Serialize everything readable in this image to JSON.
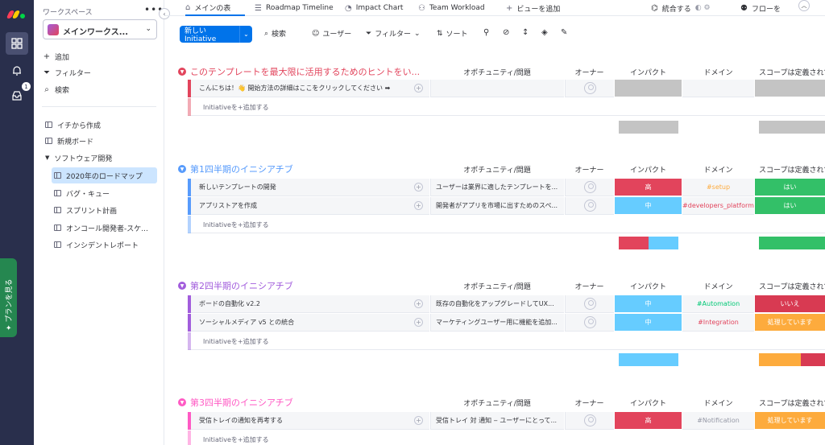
{
  "sidebar": {
    "workspace_label": "ワークスペース",
    "more_label": "•••",
    "workspace_name": "メインワークス...",
    "actions": [
      {
        "icon": "plus-icon",
        "label": "追加"
      },
      {
        "icon": "filter-icon",
        "label": "フィルター"
      },
      {
        "icon": "search-icon",
        "label": "検索"
      }
    ],
    "items": [
      {
        "label": "イチから作成"
      },
      {
        "label": "新規ボード"
      }
    ],
    "folder": {
      "label": "ソフトウェア開発"
    },
    "boards": [
      {
        "label": "2020年のロードマップ",
        "selected": true
      },
      {
        "label": "バグ・キュー"
      },
      {
        "label": "スプリント計画"
      },
      {
        "label": "オンコール開発者-スケ..."
      },
      {
        "label": "インシデントレポート"
      }
    ]
  },
  "rail": {
    "inbox_badge": "1",
    "plan_label": "プランを見る"
  },
  "tabs": {
    "items": [
      {
        "label": "メインの表",
        "active": true
      },
      {
        "label": "Roadmap Timeline"
      },
      {
        "label": "Impact Chart"
      },
      {
        "label": "Team Workload"
      },
      {
        "label": "ビューを追加"
      }
    ],
    "integrate_label": "統合する",
    "automate_label": "フローを"
  },
  "toolbar": {
    "new_label": "新しい Initiative",
    "search_label": "検索",
    "person_label": "ユーザー",
    "filter_label": "フィルター",
    "sort_label": "ソート"
  },
  "columns": {
    "opportunity": "オポチュニティ/問題",
    "owner": "オーナー",
    "impact": "インパクト",
    "domain": "ドメイン",
    "scope": "スコープは定義されて"
  },
  "add_item_label": "Initiativeを+追加する",
  "colors": {
    "high": "#e2445c",
    "medium": "#66ccff",
    "yes": "#33c068",
    "no": "#d83a52",
    "working": "#fdab3d",
    "empty": "#c4c4c4",
    "accent": "#0073ea"
  },
  "groups": [
    {
      "title": "このテンプレートを最大限に活用するためのヒントをい...",
      "color": "#e2445c",
      "rows": [
        {
          "name": "こんにちは！👋 開始方法の詳細はここをクリックしてください ➡",
          "opportunity": "",
          "impact": "",
          "impact_status": "empty",
          "domain": "",
          "domain_color": "#323338",
          "scope": "",
          "scope_status": "empty"
        }
      ]
    },
    {
      "title": "第1四半期のイニシアチブ",
      "color": "#579bfc",
      "rows": [
        {
          "name": "新しいテンプレートの開発",
          "opportunity": "ユーザーは業界に適したテンプレートを...",
          "impact": "高",
          "impact_status": "high",
          "domain": "#setup",
          "domain_color": "#fdab3d",
          "scope": "はい",
          "scope_status": "yes"
        },
        {
          "name": "アプリストアを作成",
          "opportunity": "開発者がアプリを市場に出すためのスペ...",
          "impact": "中",
          "impact_status": "medium",
          "domain": "#developers_platform",
          "domain_color": "#e2445c",
          "scope": "はい",
          "scope_status": "yes"
        }
      ]
    },
    {
      "title": "第2四半期のイニシアチブ",
      "color": "#a25ddc",
      "rows": [
        {
          "name": "ボードの自動化 v2.2",
          "opportunity": "既存の自動化をアップグレードしてUX...",
          "impact": "中",
          "impact_status": "medium",
          "domain": "#Automation",
          "domain_color": "#00c875",
          "scope": "いいえ",
          "scope_status": "no"
        },
        {
          "name": "ソーシャルメディア v5 との統合",
          "opportunity": "マーケティングユーザー用に機能を追加...",
          "impact": "中",
          "impact_status": "medium",
          "domain": "#Integration",
          "domain_color": "#e2445c",
          "scope": "処理しています",
          "scope_status": "working"
        }
      ]
    },
    {
      "title": "第3四半期のイニシアチブ",
      "color": "#ff5ac4",
      "rows": [
        {
          "name": "受信トレイの通知を再考する",
          "opportunity": "受信トレイ 対 通知 ‒ ユーザーにとって...",
          "impact": "高",
          "impact_status": "high",
          "domain": "#Notification",
          "domain_color": "#9699a6",
          "scope": "処理しています",
          "scope_status": "working"
        }
      ]
    }
  ]
}
